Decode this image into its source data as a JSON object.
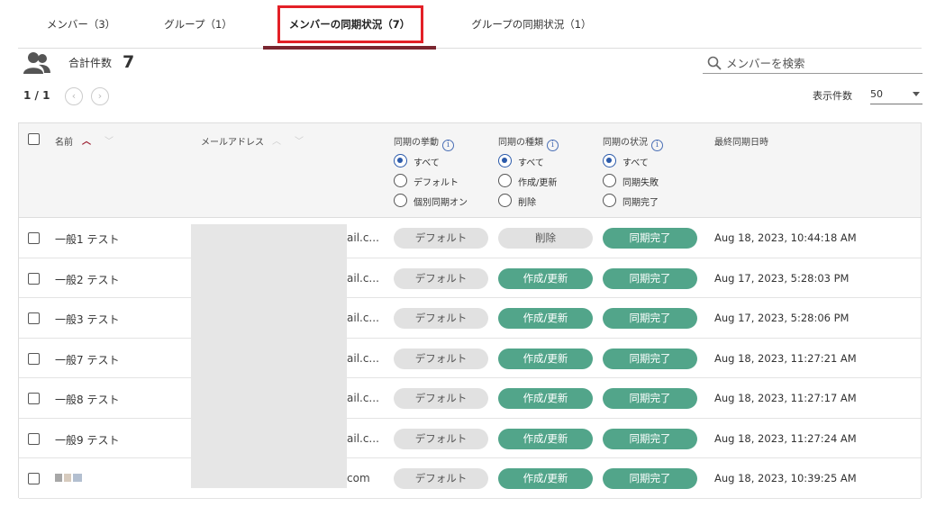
{
  "tabs": [
    {
      "label": "メンバー（3）"
    },
    {
      "label": "グループ（1）"
    },
    {
      "label": "メンバーの同期状況（7）"
    },
    {
      "label": "グループの同期状況（1）"
    }
  ],
  "summary": {
    "total_label": "合計件数",
    "total_count": "7"
  },
  "search": {
    "placeholder": "メンバーを検索"
  },
  "pager": {
    "text": "1 / 1"
  },
  "per_page": {
    "label": "表示件数",
    "value": "50"
  },
  "columns": {
    "name": "名前",
    "email": "メールアドレス",
    "behavior": "同期の挙動",
    "kind": "同期の種類",
    "status": "同期の状況",
    "last_sync": "最終同期日時"
  },
  "filters": {
    "behavior": [
      "すべて",
      "デフォルト",
      "個別同期オン"
    ],
    "kind": [
      "すべて",
      "作成/更新",
      "削除"
    ],
    "status": [
      "すべて",
      "同期失敗",
      "同期完了"
    ]
  },
  "rows": [
    {
      "name": "一般1 テスト",
      "email": "ail.c...",
      "behavior": "デフォルト",
      "kind": "削除",
      "status": "同期完了",
      "date": "Aug 18, 2023, 10:44:18 AM"
    },
    {
      "name": "一般2 テスト",
      "email": "ail.c...",
      "behavior": "デフォルト",
      "kind": "作成/更新",
      "status": "同期完了",
      "date": "Aug 17, 2023, 5:28:03 PM"
    },
    {
      "name": "一般3 テスト",
      "email": "ail.c...",
      "behavior": "デフォルト",
      "kind": "作成/更新",
      "status": "同期完了",
      "date": "Aug 17, 2023, 5:28:06 PM"
    },
    {
      "name": "一般7 テスト",
      "email": "ail.c...",
      "behavior": "デフォルト",
      "kind": "作成/更新",
      "status": "同期完了",
      "date": "Aug 18, 2023, 11:27:21 AM"
    },
    {
      "name": "一般8 テスト",
      "email": "ail.c...",
      "behavior": "デフォルト",
      "kind": "作成/更新",
      "status": "同期完了",
      "date": "Aug 18, 2023, 11:27:17 AM"
    },
    {
      "name": "一般9 テスト",
      "email": "ail.c...",
      "behavior": "デフォルト",
      "kind": "作成/更新",
      "status": "同期完了",
      "date": "Aug 18, 2023, 11:27:24 AM"
    },
    {
      "name": "",
      "email": "com",
      "behavior": "デフォルト",
      "kind": "作成/更新",
      "status": "同期完了",
      "date": "Aug 18, 2023, 10:39:25 AM"
    }
  ],
  "colors": {
    "active_tab_underline": "#7a2630",
    "highlight_box": "#e32027",
    "success_pill": "#52a58a",
    "neutral_pill": "#e1e1e1",
    "radio_selected": "#2b5aaa",
    "sort_active": "#9b1c2e"
  },
  "icons": [
    "people-icon",
    "search-icon",
    "chevron-left-icon",
    "chevron-right-icon",
    "sort-up-icon",
    "sort-down-icon",
    "info-icon",
    "dropdown-caret-icon"
  ]
}
